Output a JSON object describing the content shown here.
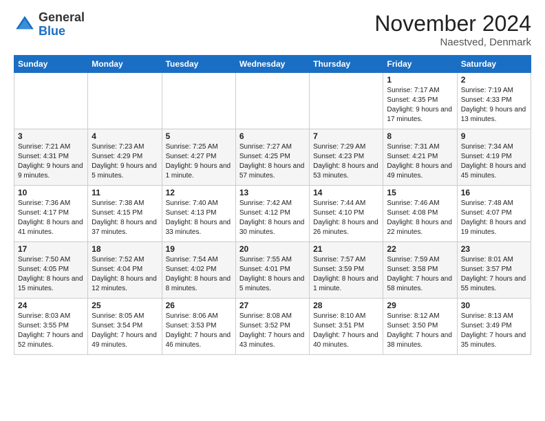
{
  "header": {
    "logo_general": "General",
    "logo_blue": "Blue",
    "month_title": "November 2024",
    "location": "Naestved, Denmark"
  },
  "weekdays": [
    "Sunday",
    "Monday",
    "Tuesday",
    "Wednesday",
    "Thursday",
    "Friday",
    "Saturday"
  ],
  "weeks": [
    [
      {
        "day": "",
        "info": ""
      },
      {
        "day": "",
        "info": ""
      },
      {
        "day": "",
        "info": ""
      },
      {
        "day": "",
        "info": ""
      },
      {
        "day": "",
        "info": ""
      },
      {
        "day": "1",
        "info": "Sunrise: 7:17 AM\nSunset: 4:35 PM\nDaylight: 9 hours and 17 minutes."
      },
      {
        "day": "2",
        "info": "Sunrise: 7:19 AM\nSunset: 4:33 PM\nDaylight: 9 hours and 13 minutes."
      }
    ],
    [
      {
        "day": "3",
        "info": "Sunrise: 7:21 AM\nSunset: 4:31 PM\nDaylight: 9 hours and 9 minutes."
      },
      {
        "day": "4",
        "info": "Sunrise: 7:23 AM\nSunset: 4:29 PM\nDaylight: 9 hours and 5 minutes."
      },
      {
        "day": "5",
        "info": "Sunrise: 7:25 AM\nSunset: 4:27 PM\nDaylight: 9 hours and 1 minute."
      },
      {
        "day": "6",
        "info": "Sunrise: 7:27 AM\nSunset: 4:25 PM\nDaylight: 8 hours and 57 minutes."
      },
      {
        "day": "7",
        "info": "Sunrise: 7:29 AM\nSunset: 4:23 PM\nDaylight: 8 hours and 53 minutes."
      },
      {
        "day": "8",
        "info": "Sunrise: 7:31 AM\nSunset: 4:21 PM\nDaylight: 8 hours and 49 minutes."
      },
      {
        "day": "9",
        "info": "Sunrise: 7:34 AM\nSunset: 4:19 PM\nDaylight: 8 hours and 45 minutes."
      }
    ],
    [
      {
        "day": "10",
        "info": "Sunrise: 7:36 AM\nSunset: 4:17 PM\nDaylight: 8 hours and 41 minutes."
      },
      {
        "day": "11",
        "info": "Sunrise: 7:38 AM\nSunset: 4:15 PM\nDaylight: 8 hours and 37 minutes."
      },
      {
        "day": "12",
        "info": "Sunrise: 7:40 AM\nSunset: 4:13 PM\nDaylight: 8 hours and 33 minutes."
      },
      {
        "day": "13",
        "info": "Sunrise: 7:42 AM\nSunset: 4:12 PM\nDaylight: 8 hours and 30 minutes."
      },
      {
        "day": "14",
        "info": "Sunrise: 7:44 AM\nSunset: 4:10 PM\nDaylight: 8 hours and 26 minutes."
      },
      {
        "day": "15",
        "info": "Sunrise: 7:46 AM\nSunset: 4:08 PM\nDaylight: 8 hours and 22 minutes."
      },
      {
        "day": "16",
        "info": "Sunrise: 7:48 AM\nSunset: 4:07 PM\nDaylight: 8 hours and 19 minutes."
      }
    ],
    [
      {
        "day": "17",
        "info": "Sunrise: 7:50 AM\nSunset: 4:05 PM\nDaylight: 8 hours and 15 minutes."
      },
      {
        "day": "18",
        "info": "Sunrise: 7:52 AM\nSunset: 4:04 PM\nDaylight: 8 hours and 12 minutes."
      },
      {
        "day": "19",
        "info": "Sunrise: 7:54 AM\nSunset: 4:02 PM\nDaylight: 8 hours and 8 minutes."
      },
      {
        "day": "20",
        "info": "Sunrise: 7:55 AM\nSunset: 4:01 PM\nDaylight: 8 hours and 5 minutes."
      },
      {
        "day": "21",
        "info": "Sunrise: 7:57 AM\nSunset: 3:59 PM\nDaylight: 8 hours and 1 minute."
      },
      {
        "day": "22",
        "info": "Sunrise: 7:59 AM\nSunset: 3:58 PM\nDaylight: 7 hours and 58 minutes."
      },
      {
        "day": "23",
        "info": "Sunrise: 8:01 AM\nSunset: 3:57 PM\nDaylight: 7 hours and 55 minutes."
      }
    ],
    [
      {
        "day": "24",
        "info": "Sunrise: 8:03 AM\nSunset: 3:55 PM\nDaylight: 7 hours and 52 minutes."
      },
      {
        "day": "25",
        "info": "Sunrise: 8:05 AM\nSunset: 3:54 PM\nDaylight: 7 hours and 49 minutes."
      },
      {
        "day": "26",
        "info": "Sunrise: 8:06 AM\nSunset: 3:53 PM\nDaylight: 7 hours and 46 minutes."
      },
      {
        "day": "27",
        "info": "Sunrise: 8:08 AM\nSunset: 3:52 PM\nDaylight: 7 hours and 43 minutes."
      },
      {
        "day": "28",
        "info": "Sunrise: 8:10 AM\nSunset: 3:51 PM\nDaylight: 7 hours and 40 minutes."
      },
      {
        "day": "29",
        "info": "Sunrise: 8:12 AM\nSunset: 3:50 PM\nDaylight: 7 hours and 38 minutes."
      },
      {
        "day": "30",
        "info": "Sunrise: 8:13 AM\nSunset: 3:49 PM\nDaylight: 7 hours and 35 minutes."
      }
    ]
  ]
}
